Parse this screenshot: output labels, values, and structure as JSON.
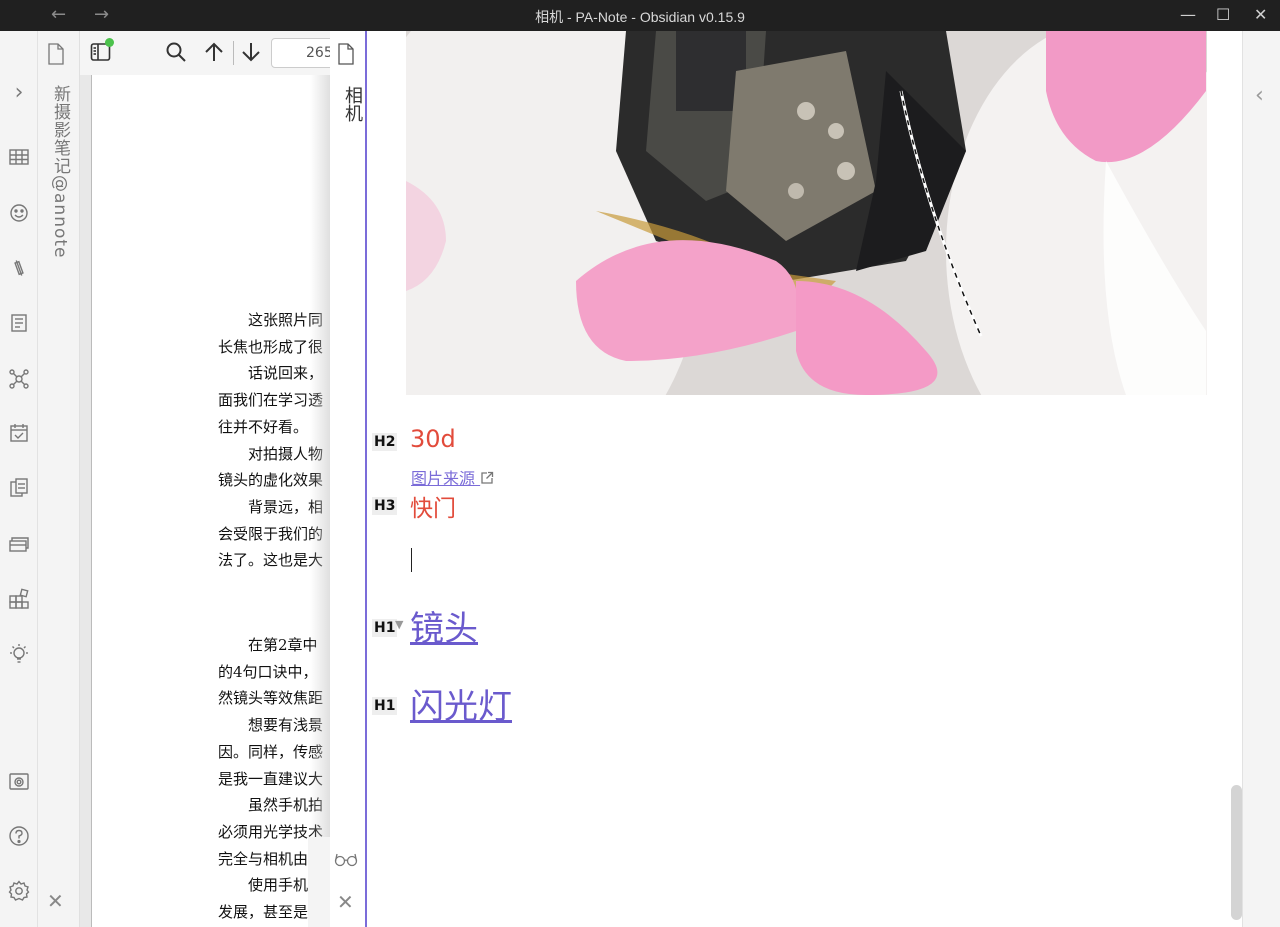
{
  "window": {
    "title": "相机 - PA-Note - Obsidian v0.15.9",
    "back_arrow": "←",
    "forward_arrow": "→",
    "minimize": "—",
    "maximize": "☐",
    "close": "✕"
  },
  "ribbon": {
    "expand": "›",
    "icons": [
      "table-icon",
      "emoji-icon",
      "link-icon",
      "template-icon",
      "graph-icon",
      "calendar-icon",
      "copy-icon",
      "layers-icon",
      "grid-icon",
      "lightbulb-icon",
      "camera-icon",
      "help-icon",
      "settings-icon"
    ]
  },
  "left_tab": {
    "title": "新摄影笔记@annote",
    "close": "✕"
  },
  "pdf": {
    "page_number": "265",
    "lines": [
      "　　这张照片同",
      "长焦也形成了很",
      "　　话说回来，",
      "面我们在学习透",
      "往并不好看。",
      "　　对拍摄人物",
      "镜头的虚化效果",
      "　　背景远，相",
      "会受限于我们的",
      "法了。这也是大"
    ],
    "lines2": [
      "　　在第2章中",
      "的4句口诀中，",
      "然镜头等效焦距",
      "　　想要有浅景",
      "因。同样，传感",
      "是我一直建议大",
      "　　虽然手机拍",
      "必须用光学技术",
      "完全与相机由光",
      "　　使用手机的",
      "发展，甚至是小"
    ]
  },
  "note_tab": {
    "title": "相机",
    "reading_icon": "glasses-icon",
    "close": "✕"
  },
  "note": {
    "h2_level": "H2",
    "h2_text": "30d",
    "link_text": "图片来源",
    "h3_level": "H3",
    "h3_text": "快门",
    "h1a_level": "H1",
    "h1a_text": "镜头",
    "h1b_level": "H1",
    "h1b_text": "闪光灯"
  },
  "right_panel": {
    "expand": "‹"
  },
  "colors": {
    "heading_red": "#e24b3b",
    "link_purple": "#6a5acd",
    "accent": "#7b6cd9",
    "titlebar": "#202020"
  }
}
